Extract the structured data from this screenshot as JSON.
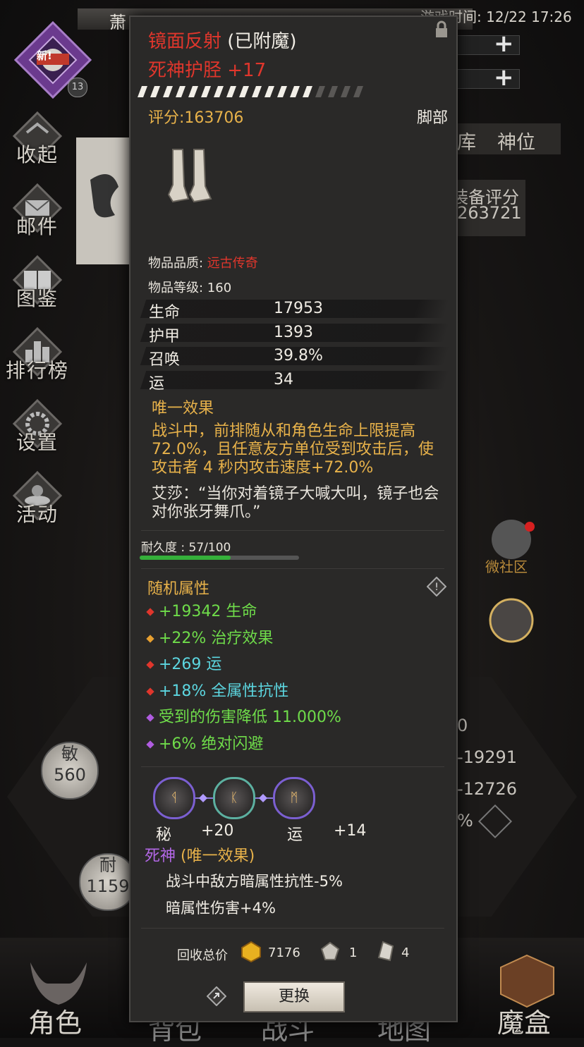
{
  "hud": {
    "game_time": "游戏时间: 12/22 17:26",
    "player_name": "萧",
    "new_badge": "新!",
    "level": "13",
    "right_tabs": [
      "库",
      "神位"
    ],
    "equip_score_label": "装备评分",
    "equip_score_value": "263721",
    "side_menu": [
      {
        "label": "收起",
        "icon": "collapse-icon"
      },
      {
        "label": "邮件",
        "icon": "mail-icon"
      },
      {
        "label": "图鉴",
        "icon": "book-icon"
      },
      {
        "label": "排行榜",
        "icon": "ranking-icon"
      },
      {
        "label": "设置",
        "icon": "gear-icon"
      },
      {
        "label": "活动",
        "icon": "event-icon"
      }
    ],
    "community_label": "微社区",
    "stat_circles": [
      {
        "label": "敏",
        "value": "560"
      },
      {
        "label": "耐",
        "value": "1159"
      }
    ],
    "right_values": [
      "0",
      "-19291",
      "-12726",
      "%"
    ],
    "bottom_tabs": [
      "角色",
      "背包",
      "战斗",
      "地图",
      "魔盒"
    ]
  },
  "item": {
    "name": "镜面反射",
    "enchant_tag": "(已附魔)",
    "subtitle": "死神护胫 +17",
    "stars_filled": 14,
    "stars_total": 18,
    "score": "评分:163706",
    "slot": "脚部",
    "quality_label": "物品品质: ",
    "quality_value": "远古传奇",
    "item_level": "物品等级: 160",
    "stats": [
      {
        "name": "生命",
        "value": "17953"
      },
      {
        "name": "护甲",
        "value": "1393"
      },
      {
        "name": "召唤",
        "value": "39.8%"
      },
      {
        "name": "运",
        "value": "34"
      }
    ],
    "unique_title": "唯一效果",
    "unique_text": "战斗中，前排随从和角色生命上限提高72.0%，且任意友方单位受到攻击后，使攻击者 4 秒内攻击速度+72.0%",
    "quote": "艾莎：“当你对着镜子大喊大叫，镜子也会对你张牙舞爪。”",
    "durability_text": "耐久度 : 57/100",
    "durability": 0.57,
    "random_title": "随机属性",
    "affixes": [
      {
        "text": "+19342 生命",
        "color": "#6fdc4a",
        "dot": "#e0362c"
      },
      {
        "text": "+22% 治疗效果",
        "color": "#6fdc4a",
        "dot": "#e8a030"
      },
      {
        "text": "+269 运",
        "color": "#5cd6e0",
        "dot": "#e0362c"
      },
      {
        "text": "+18% 全属性抗性",
        "color": "#5cd6e0",
        "dot": "#e0362c"
      },
      {
        "text": "受到的伤害降低 11.000%",
        "color": "#6fdc4a",
        "dot": "#b05ce0"
      },
      {
        "text": "+6% 绝对闪避",
        "color": "#6fdc4a",
        "dot": "#b05ce0"
      }
    ],
    "gems": [
      {
        "glyph": "ᛩ",
        "border": "#7b5fd1"
      },
      {
        "glyph": "ᛕ",
        "border": "#5cb0a0"
      },
      {
        "glyph": "ᛗ",
        "border": "#7b5fd1"
      }
    ],
    "gem_bonus": [
      {
        "name": "秘",
        "value": "+20"
      },
      {
        "name": "运",
        "value": "+14"
      }
    ],
    "set_name": "死神",
    "set_tag": " (唯一效果)",
    "set_lines": [
      "战斗中敌方暗属性抗性-5%",
      "暗属性伤害+4%"
    ],
    "recycle_label": "回收总价",
    "recycle_values": [
      "7176",
      "1",
      "4"
    ],
    "replace_button": "更换"
  }
}
